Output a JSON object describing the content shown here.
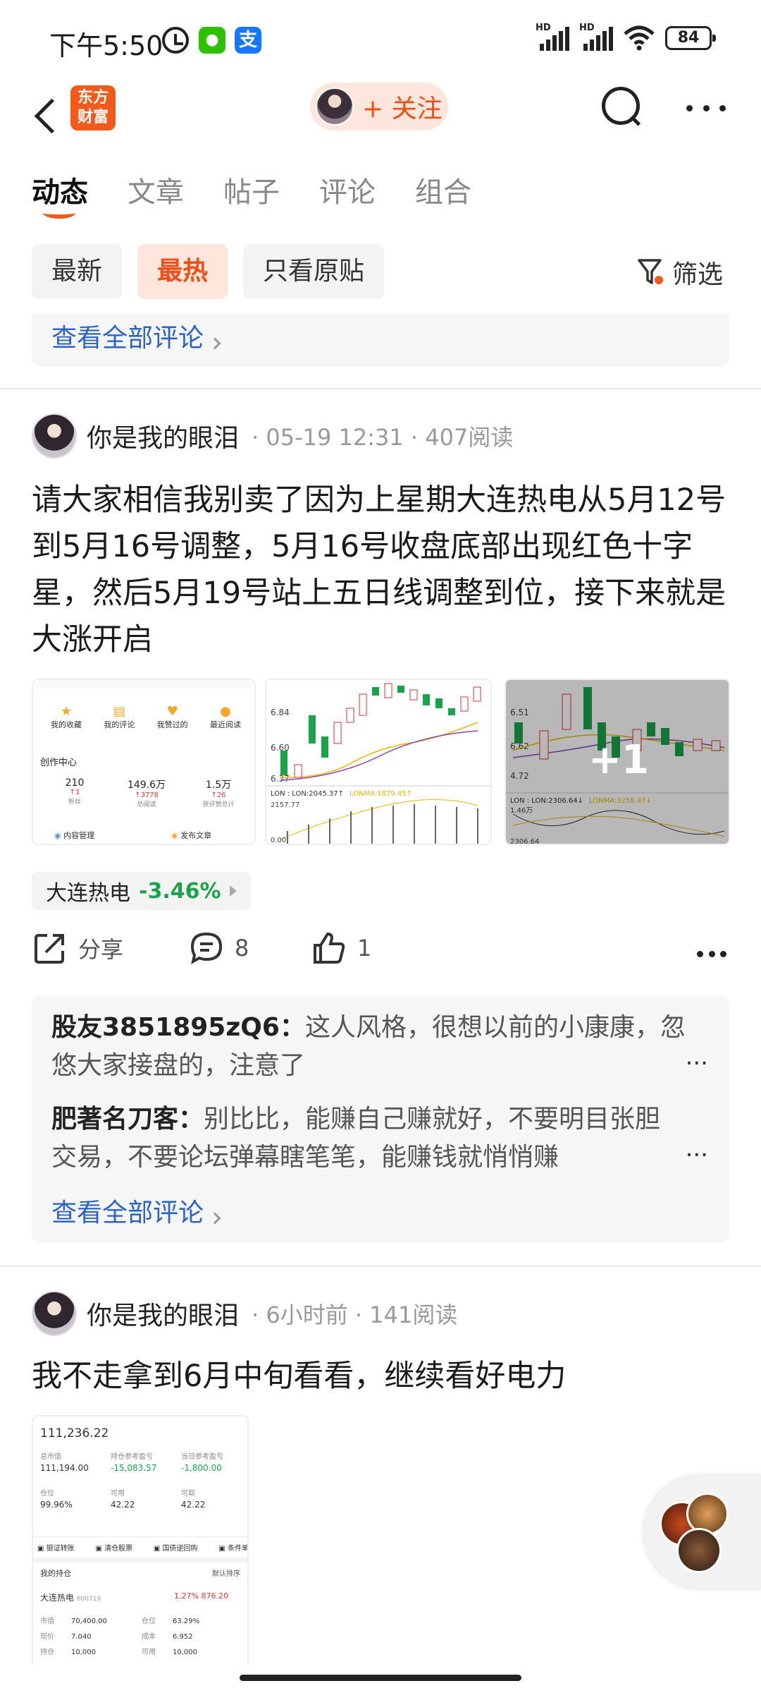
{
  "status_bar": {
    "time": "下午5:50",
    "battery": "84",
    "signal_label": "HD"
  },
  "header": {
    "logo_line1": "东方",
    "logo_line2": "财富",
    "follow_label": "+ 关注"
  },
  "tabs": [
    {
      "label": "动态",
      "active": true
    },
    {
      "label": "文章",
      "active": false
    },
    {
      "label": "帖子",
      "active": false
    },
    {
      "label": "评论",
      "active": false
    },
    {
      "label": "组合",
      "active": false
    }
  ],
  "filters": {
    "chips": [
      "最新",
      "最热",
      "只看原贴"
    ],
    "active": "最热",
    "filter_label": "筛选"
  },
  "prev_card": {
    "view_all": "查看全部评论"
  },
  "post1": {
    "username": "你是我的眼泪",
    "time": "05-19 12:31",
    "reads": "407阅读",
    "text": "请大家相信我别卖了因为上星期大连热电从5月12号到5月16号调整，5月16号收盘底部出现红色十字星，然后5月19号站上五日线调整到位，接下来就是大涨开启",
    "thumb1": {
      "items": [
        "我的收藏",
        "我的评论",
        "我赞过的",
        "最近阅读"
      ],
      "section": "创作中心",
      "stats": [
        {
          "value": "210",
          "delta": "↑1",
          "label": "粉丝"
        },
        {
          "value": "149.6万",
          "delta": "↑3778",
          "label": "总阅读"
        },
        {
          "value": "1.5万",
          "delta": "↑26",
          "label": "获评赞总计"
        }
      ],
      "buttons": [
        "内容管理",
        "发布文章"
      ]
    },
    "thumb2": {
      "p1": "6.84",
      "p2": "6.60",
      "p3": "6.37",
      "lon": "LON : LON:2045.37↑",
      "lonma": "LONMA:1879.45↑",
      "v": "2157.77",
      "zero": "0.00"
    },
    "thumb3": {
      "p1": "6.51",
      "p2": "6.62",
      "p3": "4.72",
      "lon": "LON : LON:2306.64↓",
      "lonma": "LONMA:3258.47↓",
      "v": "1.46万",
      "low": "2306.64",
      "more": "+1"
    },
    "stock": {
      "name": "大连热电",
      "change": "-3.46%"
    },
    "share_label": "分享",
    "comment_count": "8",
    "like_count": "1",
    "comments": [
      {
        "author": "股友3851895zQ6：",
        "text": "这人风格，很想以前的小康康，忽悠大家接盘的，注意了"
      },
      {
        "author": "肥著名刀客：",
        "text": "别比比，能赚自己赚就好，不要明目张胆交易，不要论坛弹幕瞎笔笔，能赚钱就悄悄赚"
      }
    ],
    "view_all": "查看全部评论",
    "ellipsis": "..."
  },
  "post2": {
    "username": "你是我的眼泪",
    "time": "6小时前",
    "reads": "141阅读",
    "text": "我不走拿到6月中旬看看，继续看好电力",
    "thumb": {
      "total": "111,236.22",
      "l1": [
        "总市值",
        "持仓参考盈亏",
        "当日参考盈亏"
      ],
      "v1": [
        "111,194.00",
        "-15,083.57",
        "-1,800.00"
      ],
      "l2": [
        "仓位",
        "可用",
        "可取"
      ],
      "v2": [
        "99.96%",
        "42.22",
        "42.22"
      ],
      "menu": [
        "银证转账",
        "清仓股票",
        "国债逆回购",
        "条件单"
      ],
      "holdings": "我的持仓",
      "sort": "默认排序",
      "stock_name": "大连热电",
      "stock_code": "600719",
      "stock_pct": "1.27%",
      "stock_val": "876.20",
      "rows": [
        [
          "市值",
          "70,400.00",
          "仓位",
          "63.29%"
        ],
        [
          "现价",
          "7.040",
          "成本",
          "6.952"
        ],
        [
          "持仓",
          "10,000",
          "可用",
          "10,000"
        ]
      ]
    }
  }
}
